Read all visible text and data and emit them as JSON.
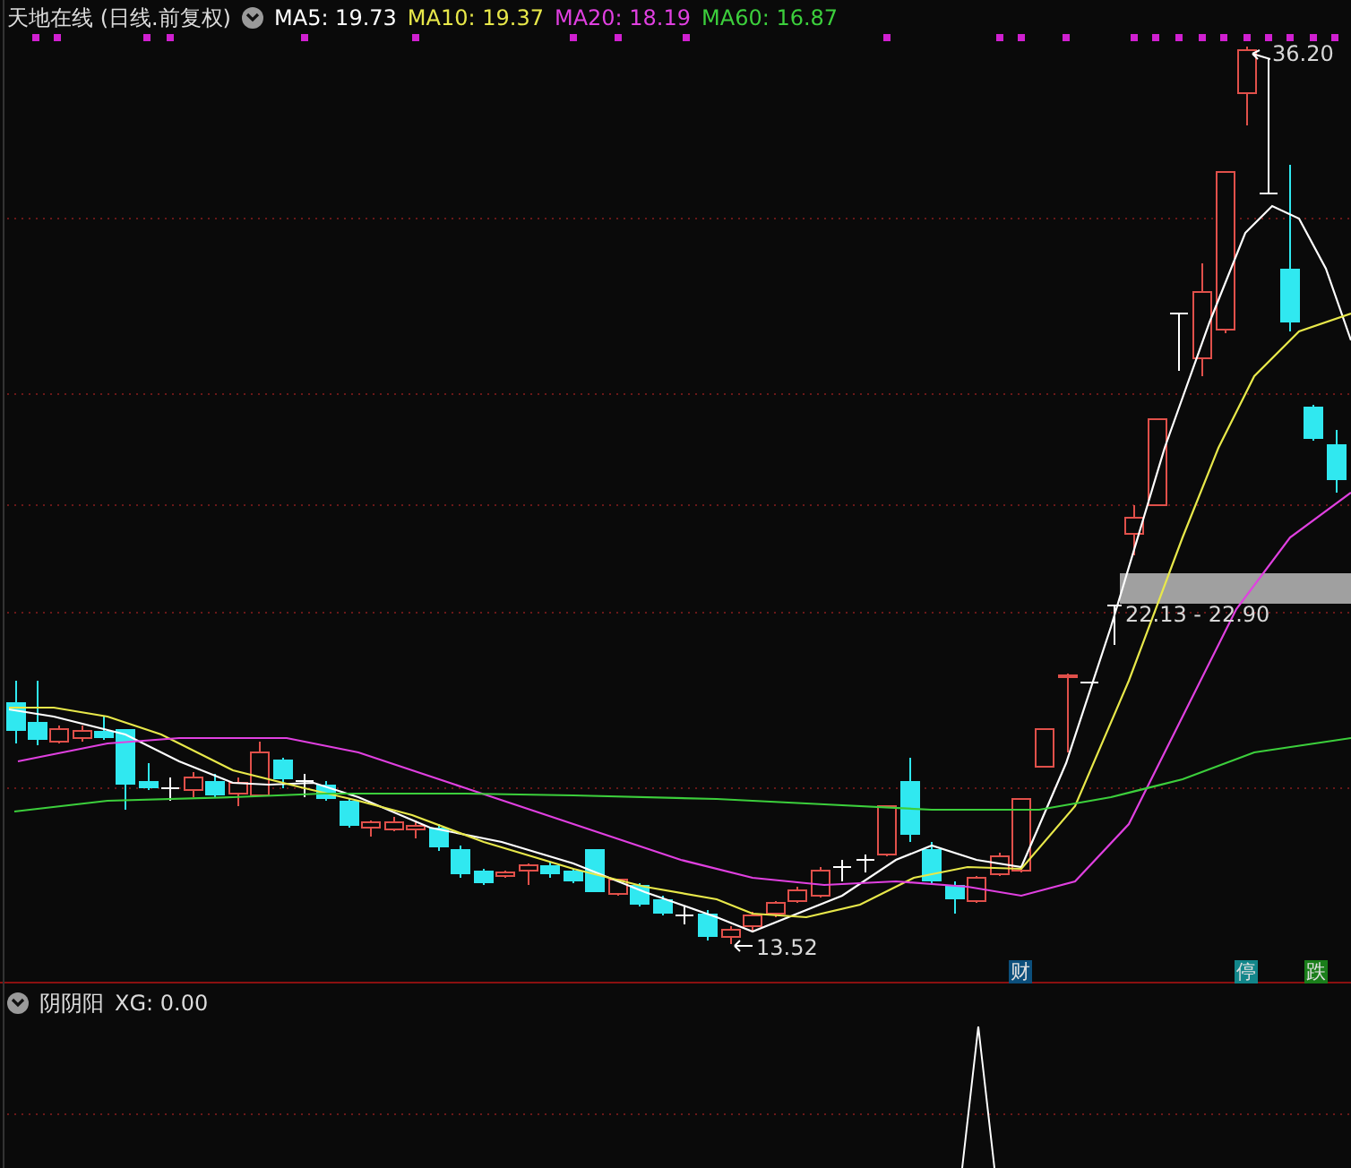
{
  "main_panel": {
    "title": "天地在线 (日线.前复权)",
    "indicators": [
      {
        "label": "MA5: 19.73",
        "color": "#ffffff"
      },
      {
        "label": "MA10: 19.37",
        "color": "#e8e84a"
      },
      {
        "label": "MA20: 18.19",
        "color": "#e040e0"
      },
      {
        "label": "MA60: 16.87",
        "color": "#3ccf3c"
      }
    ],
    "high_label": "36.20",
    "low_label": "13.52",
    "range_label": "22.13 - 22.90",
    "markers": [
      {
        "text": "财",
        "color": "#0c4f7c"
      },
      {
        "text": "停",
        "color": "#12868a"
      },
      {
        "text": "跌",
        "color": "#1a7e1a"
      }
    ]
  },
  "sub_panel": {
    "title": "阴阴阳",
    "reading": "XG: 0.00"
  }
}
